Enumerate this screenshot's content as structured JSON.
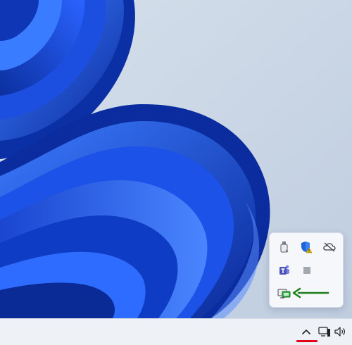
{
  "desktop": {
    "wallpaper": "windows-11-bloom",
    "colors": {
      "background": "#c9d5e3",
      "bloom_dark": "#0a2fa8",
      "bloom_light": "#2f6bff",
      "taskbar": "#eef2f7",
      "annotation_arrow": "#1a7f1a",
      "annotation_underline": "#e3001b"
    }
  },
  "tray_flyout": {
    "icons": [
      {
        "name": "usb-drive-icon"
      },
      {
        "name": "security-shield-warning-icon"
      },
      {
        "name": "onedrive-offline-icon"
      },
      {
        "name": "microsoft-teams-icon"
      },
      {
        "name": "blank-app-icon"
      },
      {
        "name": "remote-monitor-icon",
        "highlighted": true
      }
    ]
  },
  "taskbar": {
    "tray": [
      {
        "name": "show-hidden-icons-chevron-icon",
        "active": true
      },
      {
        "name": "network-icon"
      },
      {
        "name": "volume-icon"
      }
    ]
  }
}
